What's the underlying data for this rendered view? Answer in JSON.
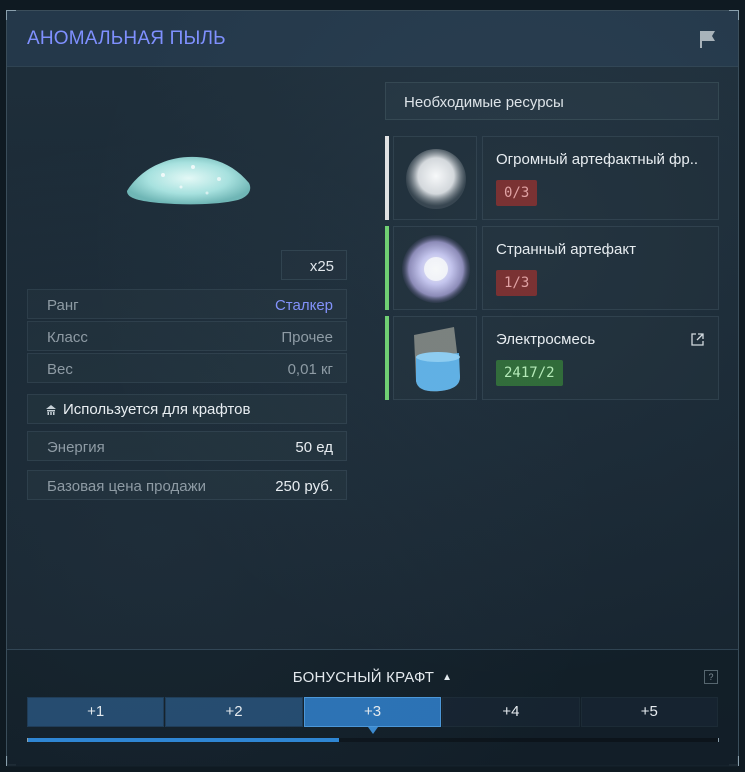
{
  "title": "АНОМАЛЬНАЯ ПЫЛЬ",
  "item": {
    "quantity": "x25",
    "stats": [
      {
        "label": "Ранг",
        "value": "Сталкер"
      },
      {
        "label": "Класс",
        "value": "Прочее"
      },
      {
        "label": "Вес",
        "value": "0,01 кг"
      }
    ],
    "uses_text": "Используется для крафтов",
    "energy": {
      "label": "Энергия",
      "value": "50 ед"
    },
    "price": {
      "label": "Базовая цена продажи",
      "value": "250 руб."
    }
  },
  "resources": {
    "header": "Необходимые ресурсы",
    "items": [
      {
        "name": "Огромный артефактный фр..",
        "count": "0/3",
        "status": "insufficient",
        "bar_color": "#e6e6e6",
        "icon": "huge-artifact-fragment-icon"
      },
      {
        "name": "Странный артефакт",
        "count": "1/3",
        "status": "insufficient",
        "bar_color": "#6fd36f",
        "icon": "strange-artifact-icon"
      },
      {
        "name": "Электросмесь",
        "count": "2417/2",
        "status": "sufficient",
        "bar_color": "#6fd36f",
        "icon": "electromix-icon"
      }
    ]
  },
  "bonus": {
    "title": "БОНУСНЫЙ КРАФТ",
    "tabs": [
      "+1",
      "+2",
      "+3",
      "+4",
      "+5"
    ],
    "active_tab": "+3",
    "progress": 0.45
  },
  "colors": {
    "accent": "#7f90ff",
    "red_badge": "#7a2a2a",
    "green_badge": "#2d6a34",
    "active_tab": "#2b72b5"
  }
}
